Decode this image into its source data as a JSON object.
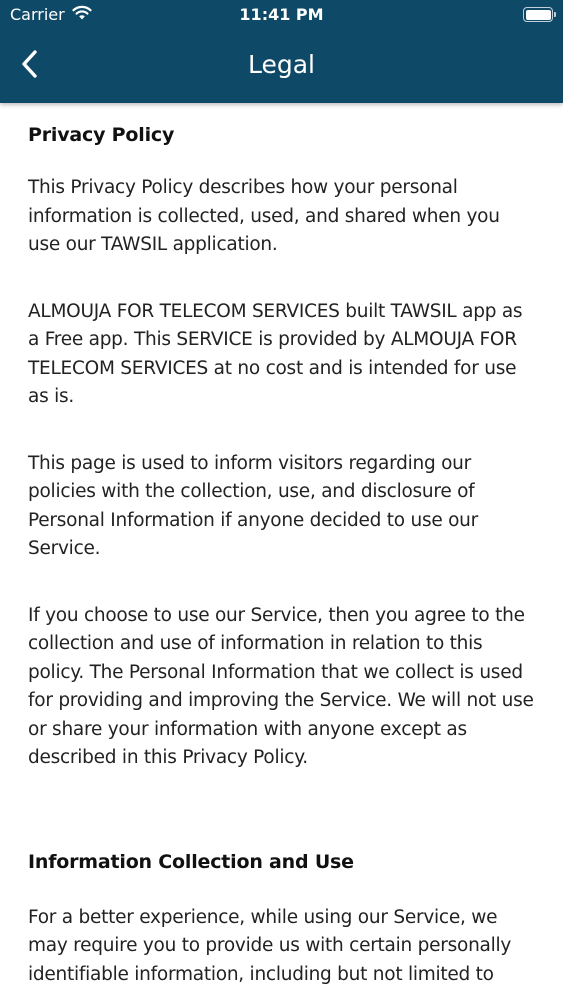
{
  "status_bar": {
    "carrier": "Carrier",
    "time": "11:41 PM"
  },
  "nav": {
    "title": "Legal"
  },
  "colors": {
    "header_bg": "#0e4a68",
    "text": "#222222"
  },
  "content": {
    "heading_1": "Privacy Policy",
    "para_1": "This Privacy Policy describes how your personal information is collected, used, and shared when you use our TAWSIL application.",
    "para_2": "ALMOUJA FOR TELECOM SERVICES built TAWSIL app as a Free app. This SERVICE is provided by ALMOUJA FOR TELECOM SERVICES at no cost and is intended for use as is.",
    "para_3": "This page is used to inform visitors regarding our policies with the collection, use, and disclosure of Personal Information if anyone decided to use our Service.",
    "para_4": "If you choose to use our Service, then you agree to the collection and use of information in relation to this policy. The Personal Information that we collect is used for providing and improving the Service. We will not use or share your information with anyone except as described in this Privacy Policy.",
    "heading_2": "Information Collection and Use",
    "para_5": "For a better experience, while using our Service, we may require you to provide us with certain personally identifiable information, including but not limited to"
  }
}
